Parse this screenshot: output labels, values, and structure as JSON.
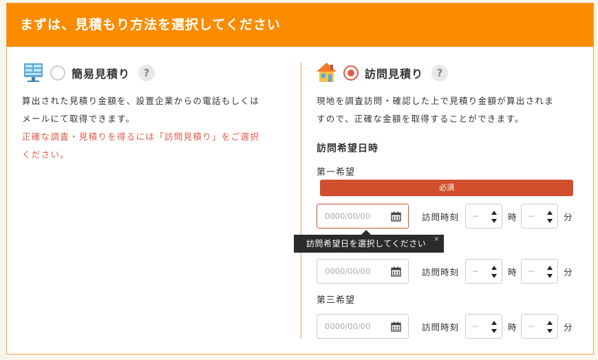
{
  "header": {
    "title": "まずは、見積もり方法を選択してください"
  },
  "simple": {
    "title": "簡易見積り",
    "help": "?",
    "desc1": "算出された見積り金額を、設置企業からの電話もしくは",
    "desc2": "メールにて取得できます。",
    "note1": "正確な調査・見積りを得るには「訪問見積り」をご選択",
    "note2": "ください。",
    "icon": "computer-icon",
    "selected": false
  },
  "visit": {
    "title": "訪問見積り",
    "help": "?",
    "desc1": "現地を調査訪問・確認した上で見積り金額が算出されま",
    "desc2": "すので、正確な金額を取得することができます。",
    "icon": "house-icon",
    "selected": true,
    "section_title": "訪問希望日時",
    "required_label": "必須",
    "tooltip": "訪問希望日を選択してください",
    "tooltip_close": "×",
    "preferences": [
      {
        "label": "第一希望",
        "date_placeholder": "0000/00/00",
        "time_label": "訪問時刻",
        "hour_value": "--",
        "hour_unit": "時",
        "minute_value": "--",
        "minute_unit": "分"
      },
      {
        "label": "",
        "date_placeholder": "0000/00/00",
        "time_label": "訪問時刻",
        "hour_value": "--",
        "hour_unit": "時",
        "minute_value": "--",
        "minute_unit": "分"
      },
      {
        "label": "第三希望",
        "date_placeholder": "0000/00/00",
        "time_label": "訪問時刻",
        "hour_value": "--",
        "hour_unit": "時",
        "minute_value": "--",
        "minute_unit": "分"
      }
    ]
  },
  "colors": {
    "accent": "#fb8c00",
    "error": "#d24f2d",
    "note": "#e05a47"
  }
}
